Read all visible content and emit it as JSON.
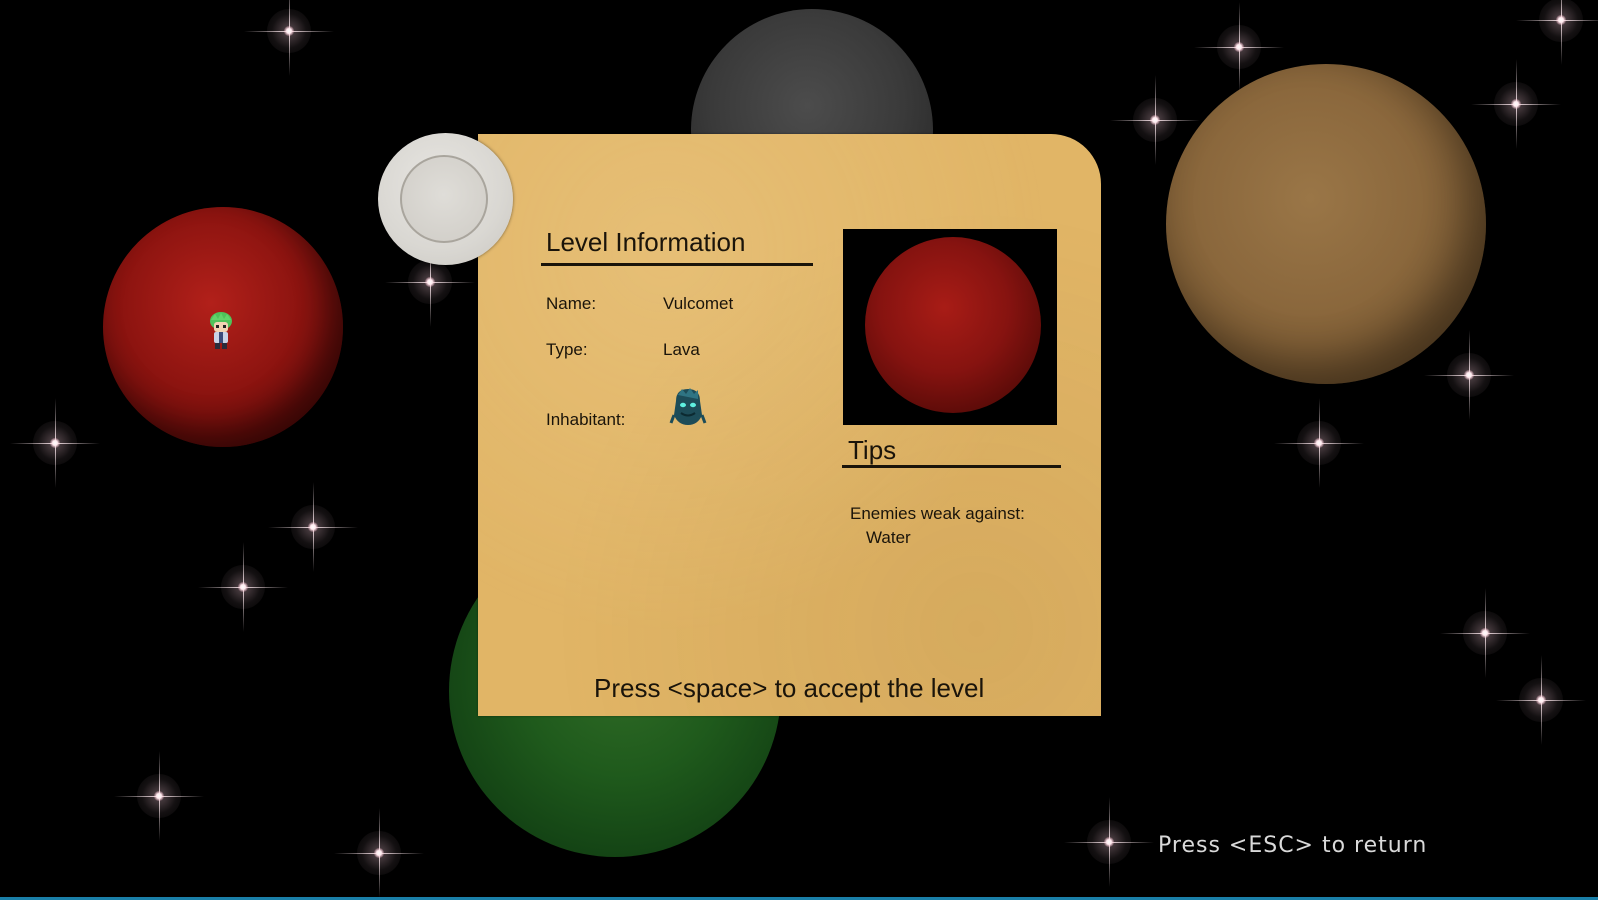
{
  "card": {
    "title": "Level Information",
    "fields": [
      {
        "label": "Name:",
        "value": "Vulcomet"
      },
      {
        "label": "Type:",
        "value": "Lava"
      },
      {
        "label": "Inhabitant:"
      }
    ],
    "tips_title": "Tips",
    "tips_line1": "Enemies weak against:",
    "tips_line2": "Water",
    "accept_prompt": "Press <space> to accept the level"
  },
  "footer": {
    "esc_prompt": "Press <ESC> to return"
  },
  "colors": {
    "card": "#e1b566",
    "ink": "#1a140a",
    "background": "#000000",
    "red_planet": "#8d1410",
    "tan_planet": "#8a673c",
    "green_planet": "#1f5a1c",
    "grey_planet": "#3a3a3a",
    "prompt_text": "#d9d9d9"
  },
  "icons": {
    "player": "player-sprite-icon",
    "inhabitant": "inhabitant-monster-icon",
    "scroll": "scroll-roll-icon"
  }
}
